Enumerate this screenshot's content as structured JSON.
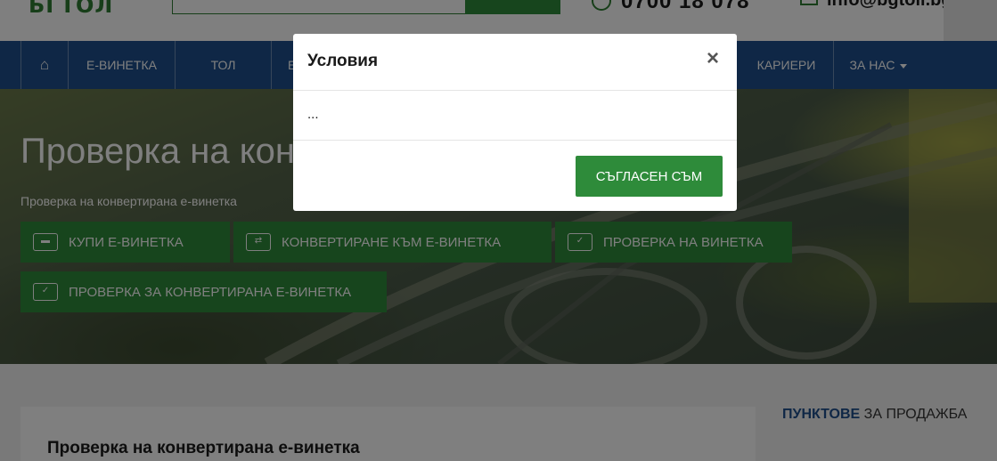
{
  "header": {
    "logo": "БГТОЛ",
    "phone": "0700 18 078",
    "email": "info@bgtoll.bg"
  },
  "nav": {
    "home_icon": "⌂",
    "items": [
      "Е-ВИНЕТКА",
      "ТОЛ",
      "Е",
      "КАРИЕРИ",
      "ЗА НАС"
    ]
  },
  "hero": {
    "title": "Проверка на конвертирана е-винетка",
    "subtitle": "Проверка на конвертирана е-винетка",
    "buttons": [
      {
        "label": "КУПИ Е-ВИНЕТКА",
        "icon": "car-ticket-icon"
      },
      {
        "label": "КОНВЕРТИРАНЕ КЪМ Е-ВИНЕТКА",
        "icon": "shuffle-ticket-icon"
      },
      {
        "label": "ПРОВЕРКА НА ВИНЕТКА",
        "icon": "check-ticket-icon"
      },
      {
        "label": "ПРОВЕРКА ЗА КОНВЕРТИРАНА Е-ВИНЕТКА",
        "icon": "check-ticket-icon"
      }
    ]
  },
  "content": {
    "heading": "Проверка на конвертирана е-винетка",
    "sidebar_title_bold": "ПУНКТОВЕ",
    "sidebar_title_rest": " ЗА ПРОДАЖБА"
  },
  "modal": {
    "title": "Условия",
    "close": "×",
    "body": "...",
    "agree_label": "СЪГЛАСЕН СЪМ"
  },
  "colors": {
    "nav_blue": "#1e4f8c",
    "brand_green": "#2e8b3a",
    "overlay": "rgba(0,0,0,0.5)"
  }
}
